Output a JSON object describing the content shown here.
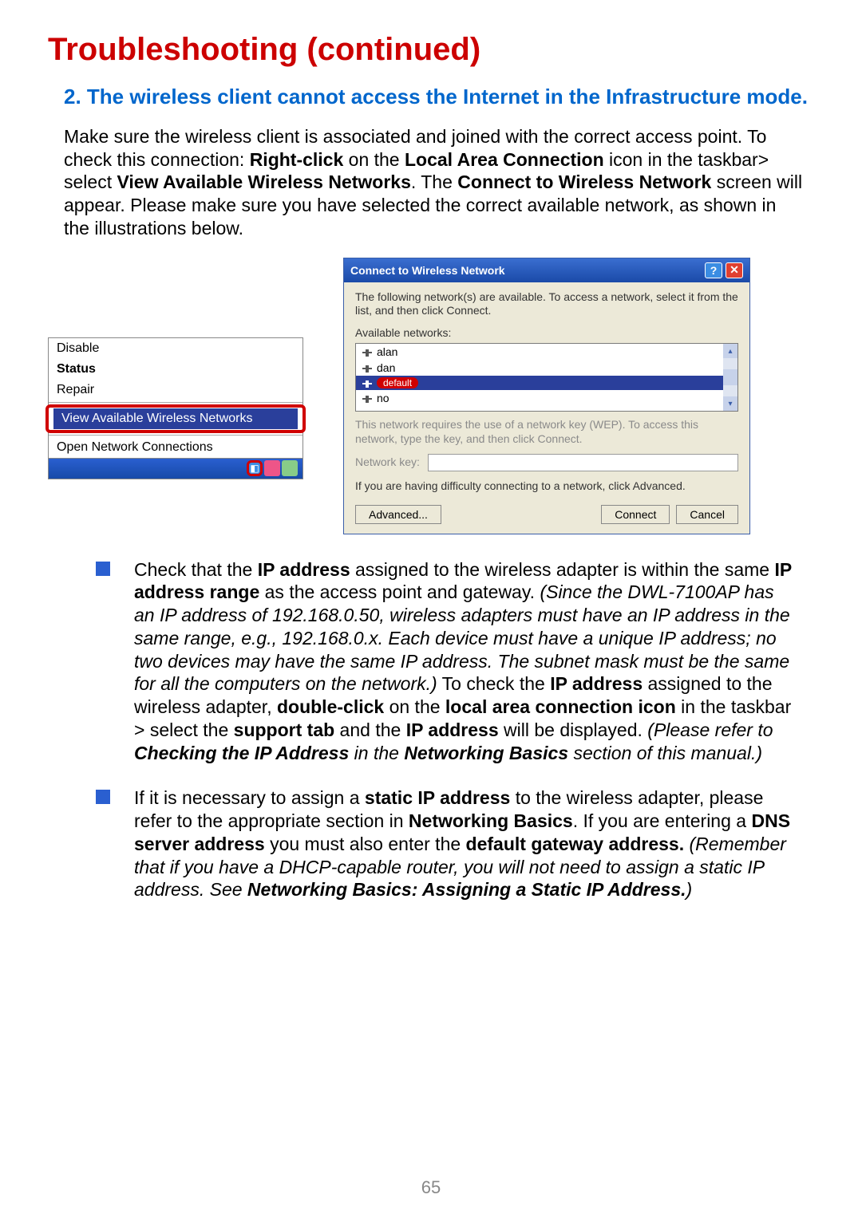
{
  "page": {
    "title": "Troubleshooting (continued)",
    "number": "65"
  },
  "section": {
    "num": "2.",
    "heading": "The wireless client cannot access the Internet in the Infrastructure mode."
  },
  "intro": {
    "t1": "Make sure the wireless client is associated and joined with the correct access point. To check this connection: ",
    "rc": "Right-click",
    "t2": " on the ",
    "lac": "Local Area Connection",
    "t3": " icon in the taskbar> select ",
    "vawn": "View Available Wireless Networks",
    "t4": ". The ",
    "ctwn": "Connect to Wireless Network",
    "t5": " screen will appear. Please make sure you have selected the correct available network, as shown in the illustrations below."
  },
  "ctxmenu": {
    "disable": "Disable",
    "status": "Status",
    "repair": "Repair",
    "view": "View Available Wireless Networks",
    "open": "Open Network Connections"
  },
  "dialog": {
    "title": "Connect to Wireless Network",
    "intro": "The following network(s) are available. To access a network, select it from the list, and then click Connect.",
    "avail_label": "Available networks:",
    "nets": {
      "0": "alan",
      "1": "dan",
      "2": "default",
      "3": "no"
    },
    "wep_note": "This network requires the use of a network key (WEP). To access this network, type the key, and then click Connect.",
    "key_label": "Network key:",
    "adv_note": "If you are having difficulty connecting to a network, click Advanced.",
    "advanced": "Advanced...",
    "connect": "Connect",
    "cancel": "Cancel"
  },
  "bullets": {
    "b1": {
      "t1": "Check that the ",
      "ip1": "IP address",
      "t2": " assigned to the wireless adapter is within the same ",
      "ipr": "IP address range",
      "t3": " as the access point and gateway. ",
      "it1": "(Since the DWL-7100AP has an IP address of 192.168.0.50, wireless adapters must have an IP address in the same range, e.g., 192.168.0.x.  Each device must have a unique IP address; no two devices may have the same IP address. The subnet mask must be the same for all the computers on the network.)",
      "t4": " To check the ",
      "ip2": "IP address",
      "t5": " assigned to the wireless adapter, ",
      "dc": "double-click",
      "t6": " on the ",
      "laci": "local area connection icon",
      "t7": " in the taskbar > select the ",
      "st": "support tab",
      "t8": " and the ",
      "ip3": "IP address",
      "t9": " will be displayed. ",
      "it2a": "(Please refer to ",
      "it2b": "Checking the IP Address",
      "it2c": " in the ",
      "it2d": "Networking Basics",
      "it2e": " section of this manual.)"
    },
    "b2": {
      "t1": "If it is necessary to assign a ",
      "sip": "static IP address",
      "t2": " to the wireless adapter, please refer to the appropriate section in ",
      "nb": "Networking Basics",
      "t3": ". If you are entering a ",
      "dns": "DNS server address",
      "t4": " you must also enter the ",
      "dga": "default gateway address.",
      "it1": " (Remember that if you have a DHCP-capable router, you will not need to assign a static IP address. See  ",
      "it2": "Networking Basics: Assigning a Static IP Address.",
      "it3": ")"
    }
  }
}
